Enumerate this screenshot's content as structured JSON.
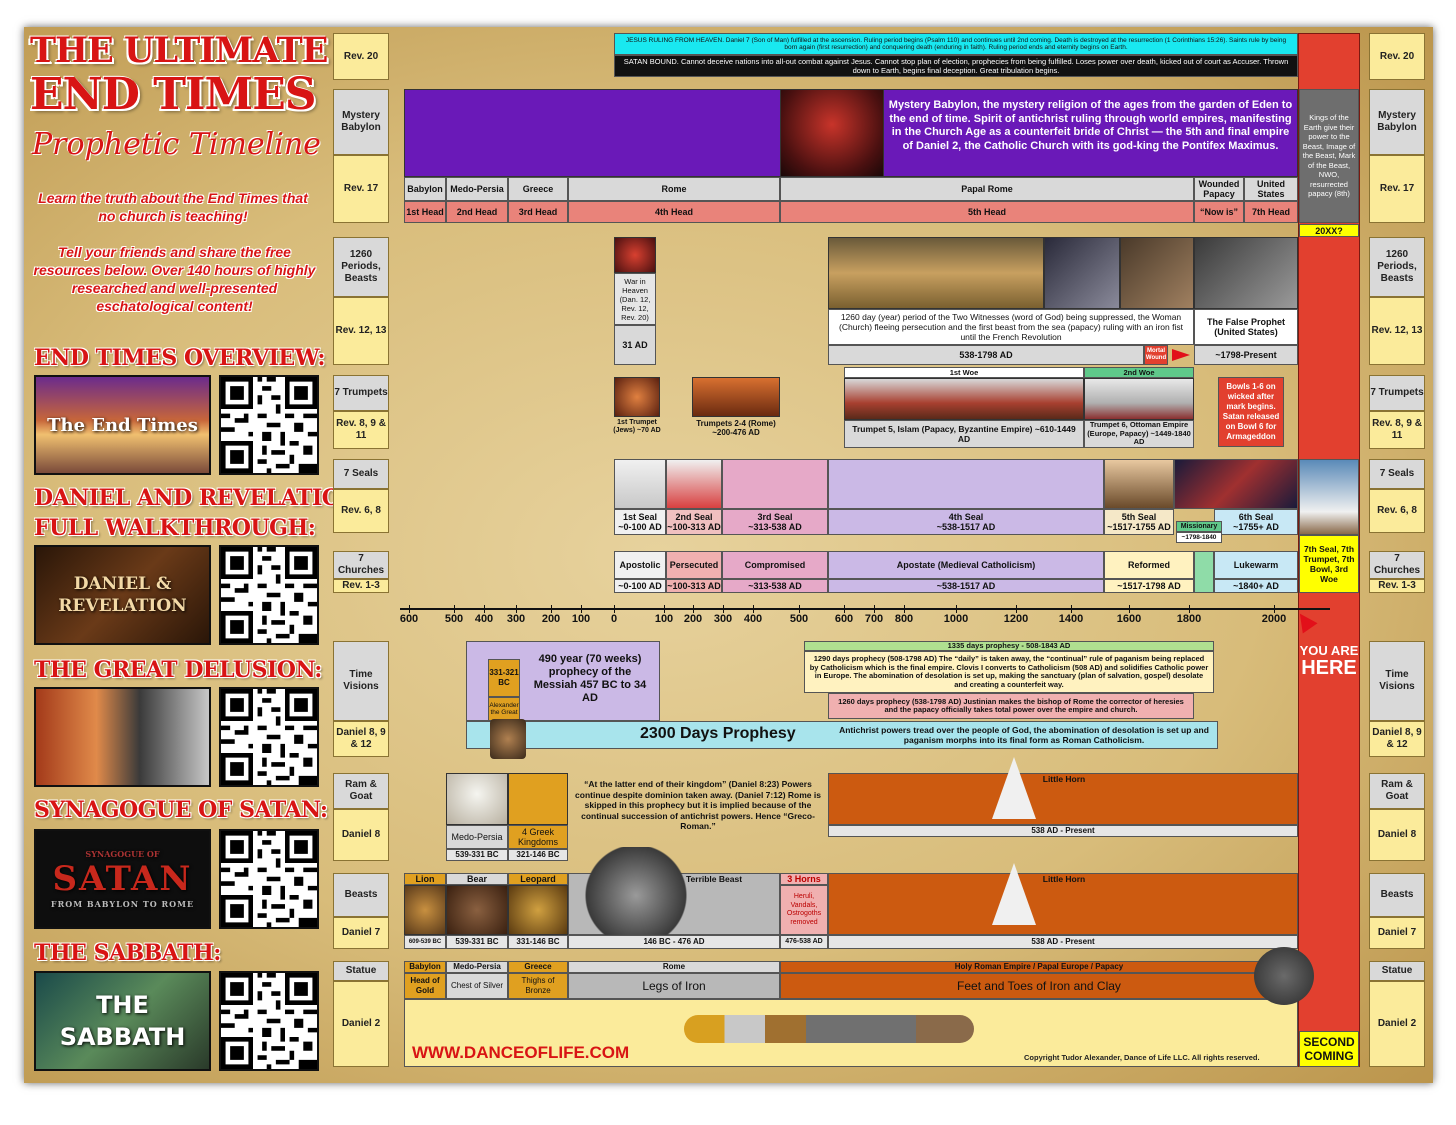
{
  "title": {
    "line1": "THE ULTIMATE",
    "line2": "END TIMES",
    "script": "Prophetic Timeline"
  },
  "intro": {
    "p1": "Learn the truth about the End Times that no church is teaching!",
    "p2": "Tell your friends and share the free resources below. Over 140 hours of highly researched and well-presented eschatological content!"
  },
  "resources": [
    {
      "heading": "END TIMES OVERVIEW:",
      "thumb": "The End Times"
    },
    {
      "heading": "DANIEL AND REVELATION",
      "heading2": "FULL WALKTHROUGH:",
      "thumb": "DANIEL & REVELATION"
    },
    {
      "heading": "THE GREAT DELUSION:",
      "thumb": ""
    },
    {
      "heading": "SYNAGOGUE OF SATAN:",
      "thumb": "SATAN",
      "thumb_top": "SYNAGOGUE OF",
      "thumb_sub": "FROM BABYLON TO ROME"
    },
    {
      "heading": "THE SABBATH:",
      "thumb": "THE SABBATH"
    }
  ],
  "row_labels": {
    "rev20": "Rev. 20",
    "mystery": "Mystery Babylon",
    "rev17": "Rev. 17",
    "periods": "1260 Periods, Beasts",
    "rev1213": "Rev. 12, 13",
    "trumpets": "7 Trumpets",
    "rev89": "Rev. 8, 9 & 11",
    "seals": "7 Seals",
    "rev68": "Rev. 6, 8",
    "churches": "7 Churches",
    "rev13": "Rev. 1-3",
    "time": "Time Visions",
    "dan8912": "Daniel 8, 9 & 12",
    "ram": "Ram & Goat",
    "dan8": "Daniel 8",
    "beasts": "Beasts",
    "dan7": "Daniel 7",
    "statue": "Statue",
    "dan2": "Daniel 2"
  },
  "rev20": {
    "cyan": "JESUS RULING FROM HEAVEN. Daniel 7 (Son of Man) fulfilled at the ascension. Ruling period begins (Psalm 110) and continues until 2nd coming. Death is destroyed at the resurrection (1 Corinthians 15:26). Saints rule by being born again (first resurrection) and conquering death (enduring in faith). Ruling period ends and eternity begins on Earth.",
    "black": "SATAN BOUND. Cannot deceive nations into all-out combat against Jesus. Cannot stop plan of election, prophecies from being fulfilled. Loses power over death, kicked out of court as Accuser. Thrown down to Earth, begins final deception. Great tribulation begins."
  },
  "mystery_babylon": "Mystery Babylon, the mystery religion of the ages from the garden of Eden to the end of time. Spirit of antichrist ruling through world empires, manifesting in the Church Age as a counterfeit bride of Christ — the 5th and final empire of Daniel 2, the Catholic Church with its god-king the Pontifex Maximus.",
  "kings": "Kings of the Earth give their power to the Beast, Image of the Beast, Mark of the Beast, NWO, resurrected papacy (8th)",
  "kings_date": "20XX?",
  "empires": [
    "Babylon",
    "Medo-Persia",
    "Greece",
    "Rome",
    "Papal Rome",
    "Wounded Papacy",
    "United States"
  ],
  "heads": [
    "1st Head",
    "2nd Head",
    "3rd Head",
    "4th Head",
    "5th Head",
    "“Now is”",
    "7th Head"
  ],
  "war_heaven": {
    "text": "War in Heaven (Dan. 12, Rev. 12, Rev. 20)",
    "date": "31 AD"
  },
  "witnesses": "1260 day (year) period of the Two Witnesses (word of God) being suppressed, the Woman (Church) fleeing persecution and the first beast from the sea (papacy) ruling with an iron fist until the French Revolution",
  "witnesses_date": "538-1798 AD",
  "mortal_wound": "Mortal Wound",
  "false_prophet": "The False Prophet (United States)",
  "false_prophet_date": "~1798-Present",
  "trumpets": {
    "t1": "1st Trumpet (Jews) ~70 AD",
    "t24": "Trumpets 2-4 (Rome) ~200-476 AD",
    "woe1": "1st Woe",
    "woe2": "2nd Woe",
    "t5": "Trumpet 5, Islam (Papacy, Byzantine Empire) ~610-1449 AD",
    "t6": "Trumpet 6, Ottoman Empire (Europe, Papacy) ~1449-1840 AD",
    "bowls": "Bowls 1-6 on wicked after mark begins. Satan released on Bowl 6 for Armageddon"
  },
  "seals": [
    {
      "name": "1st Seal",
      "date": "~0-100 AD"
    },
    {
      "name": "2nd Seal",
      "date": "~100-313 AD"
    },
    {
      "name": "3rd Seal",
      "date": "~313-538 AD"
    },
    {
      "name": "4th Seal",
      "date": "~538-1517 AD"
    },
    {
      "name": "5th Seal",
      "date": "~1517-1755 AD"
    },
    {
      "name": "6th Seal",
      "date": "~1755+ AD"
    }
  ],
  "missionary": "Missionary",
  "missionary_date": "~1798-1840",
  "seventh": "7th Seal, 7th Trumpet, 7th Bowl, 3rd Woe",
  "churches": [
    {
      "name": "Apostolic",
      "date": "~0-100 AD"
    },
    {
      "name": "Persecuted",
      "date": "~100-313 AD"
    },
    {
      "name": "Compromised",
      "date": "~313-538 AD"
    },
    {
      "name": "Apostate (Medieval Catholicism)",
      "date": "~538-1517 AD"
    },
    {
      "name": "Reformed",
      "date": "~1517-1798 AD"
    },
    {
      "name": "Lukewarm",
      "date": "~1840+ AD"
    }
  ],
  "axis": [
    "600",
    "500",
    "400",
    "300",
    "200",
    "100",
    "0",
    "100",
    "200",
    "300",
    "400",
    "500",
    "600",
    "700",
    "800",
    "1000",
    "1200",
    "1400",
    "1600",
    "1800",
    "2000"
  ],
  "you_are_here": {
    "line1": "YOU ARE",
    "line2": "HERE"
  },
  "time": {
    "bc": "331-321 BC",
    "alex": "Alexander the Great",
    "p490": "490 year (70 weeks) prophecy of the Messiah 457 BC to 34 AD",
    "p1335": "1335 days prophesy - 508-1843 AD",
    "p1290": "1290 days prophecy (508-1798 AD) The “daily” is taken away, the “continual” rule of paganism being replaced by Catholicism which is the final empire. Clovis I converts to Catholicism (508 AD) and solidifies Catholic power in Europe. The abomination of desolation is set up, making the sanctuary (plan of salvation, gospel) desolate and creating a counterfeit way.",
    "p1260": "1260 days prophecy (538-1798 AD) Justinian makes the bishop of Rome the corrector of heresies and the papacy officially takes total power over the empire and church.",
    "p2300": "2300 Days Prophesy",
    "p2300note": "Antichrist powers tread over the people of God, the abomination of desolation is set up and paganism morphs into its final form as Roman Catholicism."
  },
  "ram": {
    "medo": "Medo-Persia",
    "medo_date": "539-331 BC",
    "greek": "4 Greek Kingdoms",
    "greek_date": "321-146 BC",
    "quote": "“At the latter end of their kingdom” (Daniel 8:23) Powers continue despite dominion taken away. (Daniel 7:12) Rome is skipped in this prophecy but it is implied because of the continual succession of antichrist powers. Hence “Greco-Roman.”",
    "horn": "Little Horn",
    "horn_date": "538 AD - Present"
  },
  "beasts": {
    "lion": "Lion",
    "lion_date": "609-539 BC",
    "bear": "Bear",
    "bear_date": "539-331 BC",
    "leopard": "Leopard",
    "leopard_date": "331-146 BC",
    "terrible": "Terrible Beast",
    "terrible_date": "146 BC - 476 AD",
    "horns": "3 Horns",
    "horns_note": "Heruli, Vandals, Ostrogoths removed",
    "horns_date": "476-538 AD",
    "horn": "Little Horn",
    "horn_date": "538 AD - Present"
  },
  "statue": {
    "kingdoms": [
      "Babylon",
      "Medo-Persia",
      "Greece",
      "Rome",
      "Holy Roman Empire / Papal Europe / Papacy"
    ],
    "parts": [
      "Head of Gold",
      "Chest of Silver",
      "Thighs of Bronze",
      "Legs of Iron",
      "Feet and Toes of Iron and Clay"
    ],
    "second": "SECOND COMING"
  },
  "website": "WWW.DANCEOFLIFE.COM",
  "copyright": "Copyright Tudor Alexander, Dance of Life LLC. All rights reserved.",
  "colors": {
    "red": "#d81414",
    "yellow_label": "#fbeb9b",
    "purple": "#6a19b8",
    "cyan": "#19e8f0",
    "orange": "#cc5a10",
    "redbar": "#e2402f",
    "lavender": "#cbb9e6"
  }
}
